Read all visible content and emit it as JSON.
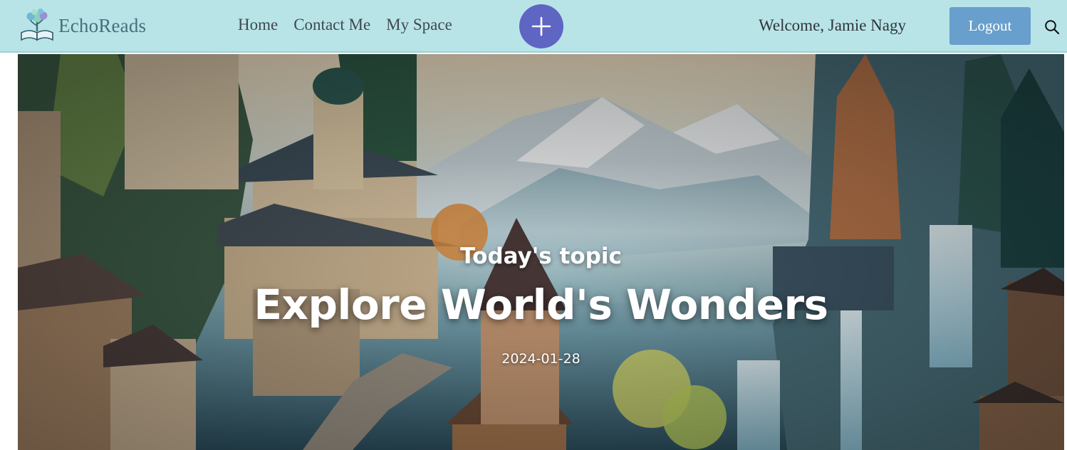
{
  "brand": {
    "name": "EchoReads",
    "logo_icon": "open-book-tree-logo"
  },
  "nav": {
    "links": [
      {
        "label": "Home"
      },
      {
        "label": "Contact Me"
      },
      {
        "label": "My Space"
      }
    ],
    "add_icon": "plus-icon",
    "welcome_prefix": "Welcome, ",
    "user_name": "Jamie Nagy",
    "logout_label": "Logout",
    "search_icon": "search-icon"
  },
  "hero": {
    "kicker": "Today's topic",
    "title": "Explore World's Wonders",
    "date": "2024-01-28",
    "image_subject": "fantasy mountain village with castle, forest and waterfalls"
  },
  "colors": {
    "navbar_bg": "#b8e4e8",
    "add_button": "#5f65c2",
    "logout_button": "#689fcc",
    "brand_text": "#46707a"
  }
}
